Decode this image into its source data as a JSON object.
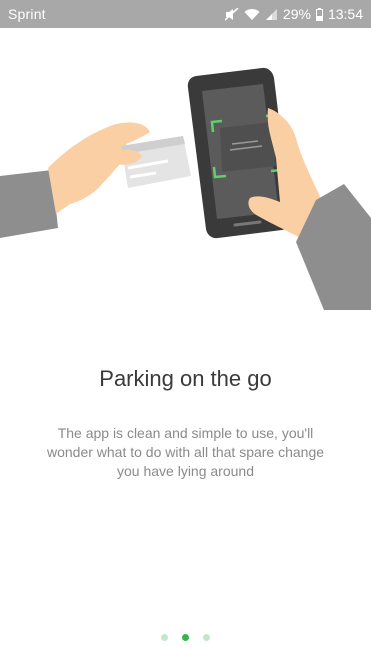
{
  "status_bar": {
    "carrier": "Sprint",
    "battery": "29%",
    "time": "13:54",
    "icons": [
      "mute-icon",
      "wifi-icon",
      "signal-icon",
      "battery-icon"
    ]
  },
  "onboarding": {
    "title": "Parking on the go",
    "description": "The app is clean and simple to use, you'll wonder what to do with all that spare change you have lying around",
    "illustration_icon": "card-scan-illustration",
    "page_count": 3,
    "active_page": 2
  },
  "colors": {
    "status_bar": "#a8a8a8",
    "accent": "#35b548",
    "accent_light": "#c6e6c9",
    "skin": "#fbcfa4",
    "sleeve": "#8e8e8e",
    "phone": "#3a3a3a",
    "screen": "#5b5b5b"
  }
}
